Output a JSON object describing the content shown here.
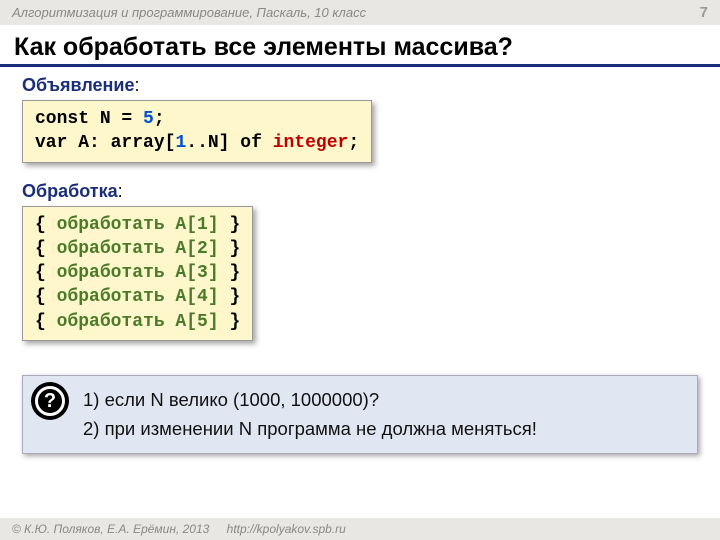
{
  "header": {
    "course": "Алгоритмизация и программирование, Паскаль, 10 класс",
    "page": "7"
  },
  "title": "Как обработать все элементы массива?",
  "declaration": {
    "label": "Объявление",
    "colon": ":",
    "code": {
      "l1_const": "const",
      "l1_n": " N",
      "l1_eq": " = ",
      "l1_val": "5",
      "l1_semi": ";",
      "l2_var": "var",
      "l2_a": " A: ",
      "l2_arr": "array",
      "l2_br1": "[",
      "l2_lo": "1",
      "l2_dots": "..N",
      "l2_br2": "] ",
      "l2_of": "of",
      "l2_sp": " ",
      "l2_type": "integer",
      "l2_semi": ";"
    }
  },
  "processing": {
    "label": "Обработка",
    "colon": ":",
    "lines": {
      "l1_open": "{ ",
      "l1_txt": "обработать A[1]",
      "l1_close": " }",
      "l2_open": "{ ",
      "l2_txt": "обработать A[2]",
      "l2_close": " }",
      "l3_open": "{ ",
      "l3_txt": "обработать A[3]",
      "l3_close": " }",
      "l4_open": "{ ",
      "l4_txt": "обработать A[4]",
      "l4_close": " }",
      "l5_open": "{ ",
      "l5_txt": "обработать A[5]",
      "l5_close": " }"
    }
  },
  "question": {
    "icon": "?",
    "q1": "1) если N велико (1000, 1000000)?",
    "q2": "2) при изменении N программа не должна меняться!"
  },
  "footer": {
    "copyright": "© К.Ю. Поляков, Е.А. Ерёмин, 2013",
    "url": "http://kpolyakov.spb.ru"
  }
}
